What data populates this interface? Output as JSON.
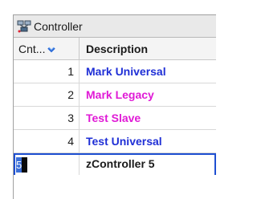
{
  "window": {
    "title": "Controller",
    "icon": "controller-network-icon"
  },
  "table": {
    "columns": [
      {
        "label": "Cnt...",
        "sort_icon": "sort-indicator-icon"
      },
      {
        "label": "Description"
      }
    ],
    "rows": [
      {
        "count": "1",
        "description": "Mark Universal",
        "color": "#1f2fd6"
      },
      {
        "count": "2",
        "description": "Mark Legacy",
        "color": "#e01ad6"
      },
      {
        "count": "3",
        "description": "Test Slave",
        "color": "#e01ad6"
      },
      {
        "count": "4",
        "description": "Test Universal",
        "color": "#1f2fd6"
      }
    ],
    "edit_row": {
      "count_value": "5",
      "description": "zController 5"
    }
  },
  "colors": {
    "accent": "#1e4fd1",
    "blue_text": "#1f2fd6",
    "magenta_text": "#e01ad6"
  }
}
